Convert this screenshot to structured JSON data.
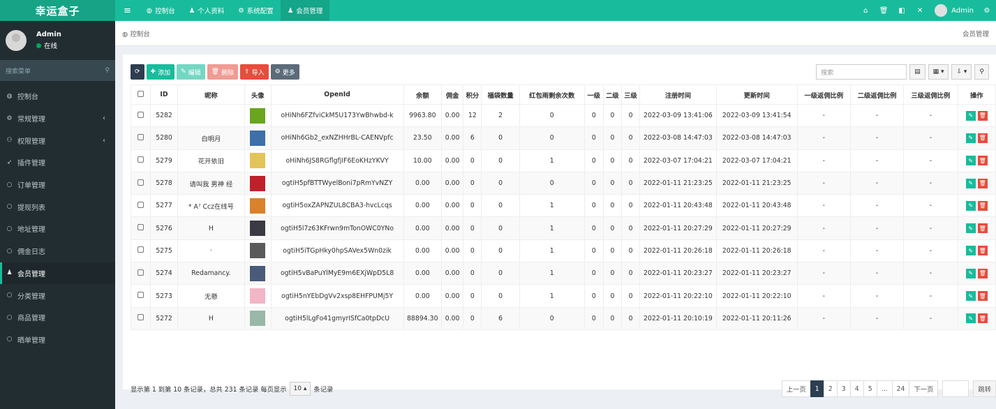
{
  "app": {
    "logo": "幸运盒子"
  },
  "topnav": {
    "items": [
      {
        "icon": "dashboard-icon",
        "glyph": "◍",
        "label": "控制台"
      },
      {
        "icon": "user-icon",
        "glyph": "♟",
        "label": "个人资料"
      },
      {
        "icon": "gear-icon",
        "glyph": "⚙",
        "label": "系统配置"
      },
      {
        "icon": "user-icon",
        "glyph": "♟",
        "label": "会员管理"
      }
    ],
    "user_name": "Admin"
  },
  "sidebar": {
    "user_name": "Admin",
    "status": "在线",
    "search_placeholder": "搜索菜单",
    "items": [
      {
        "label": "控制台",
        "glyph": "◍",
        "icon": "dashboard-icon"
      },
      {
        "label": "常规管理",
        "glyph": "⚙",
        "icon": "cogs-icon",
        "chev": "‹"
      },
      {
        "label": "权限管理",
        "glyph": "⚇",
        "icon": "group-icon",
        "chev": "‹"
      },
      {
        "label": "插件管理",
        "glyph": "➶",
        "icon": "rocket-icon"
      },
      {
        "label": "订单管理",
        "glyph": "○",
        "icon": "circle-icon"
      },
      {
        "label": "提现列表",
        "glyph": "○",
        "icon": "circle-icon"
      },
      {
        "label": "地址管理",
        "glyph": "○",
        "icon": "circle-icon"
      },
      {
        "label": "佣金日志",
        "glyph": "○",
        "icon": "circle-icon"
      },
      {
        "label": "会员管理",
        "glyph": "♟",
        "icon": "user-icon",
        "active": true
      },
      {
        "label": "分类管理",
        "glyph": "○",
        "icon": "circle-icon"
      },
      {
        "label": "商品管理",
        "glyph": "○",
        "icon": "circle-icon"
      },
      {
        "label": "晒单管理",
        "glyph": "○",
        "icon": "circle-icon"
      }
    ]
  },
  "breadcrumb": {
    "left": "控制台",
    "right": "会员管理"
  },
  "toolbar": {
    "add": "添加",
    "edit": "编辑",
    "delete": "删除",
    "import": "导入",
    "more": "更多",
    "search_placeholder": "搜索"
  },
  "table": {
    "headers": [
      "ID",
      "昵称",
      "头像",
      "OpenId",
      "余额",
      "佣金",
      "积分",
      "福袋数量",
      "红包雨剩余次数",
      "一级",
      "二级",
      "三级",
      "注册时间",
      "更新时间",
      "一级返佣比例",
      "二级返佣比例",
      "三级返佣比例",
      "操作"
    ],
    "rows": [
      {
        "id": "5282",
        "nick": "",
        "avatar_color": "#6aa51f",
        "openid": "oHiNh6FZfviCkM5U173YwBhwbd-k",
        "balance": "9963.80",
        "commission": "0.00",
        "points": "12",
        "bags": "2",
        "rain": "0",
        "l1": "0",
        "l2": "0",
        "l3": "0",
        "reg": "2022-03-09 13:41:06",
        "upd": "2022-03-09 13:41:54",
        "r1": "-",
        "r2": "-",
        "r3": "-"
      },
      {
        "id": "5280",
        "nick": "白明月",
        "avatar_color": "#3d6fa8",
        "openid": "oHiNh6Gb2_exNZHHrBL-CAENVpfc",
        "balance": "23.50",
        "commission": "0.00",
        "points": "6",
        "bags": "0",
        "rain": "0",
        "l1": "0",
        "l2": "0",
        "l3": "0",
        "reg": "2022-03-08 14:47:03",
        "upd": "2022-03-08 14:47:03",
        "r1": "-",
        "r2": "-",
        "r3": "-"
      },
      {
        "id": "5279",
        "nick": "花开依旧",
        "avatar_color": "#e3c45a",
        "openid": "oHiNh6JS8RGflgfjIF6EoKHzYKVY",
        "balance": "10.00",
        "commission": "0.00",
        "points": "0",
        "bags": "0",
        "rain": "1",
        "l1": "0",
        "l2": "0",
        "l3": "0",
        "reg": "2022-03-07 17:04:21",
        "upd": "2022-03-07 17:04:21",
        "r1": "-",
        "r2": "-",
        "r3": "-"
      },
      {
        "id": "5278",
        "nick": "请叫我 男神 经",
        "avatar_color": "#c0202a",
        "openid": "ogtiH5pfBTTWyelBoni7pRmYvNZY",
        "balance": "0.00",
        "commission": "0.00",
        "points": "0",
        "bags": "0",
        "rain": "0",
        "l1": "0",
        "l2": "0",
        "l3": "0",
        "reg": "2022-01-11 21:23:25",
        "upd": "2022-01-11 21:23:25",
        "r1": "-",
        "r2": "-",
        "r3": "-"
      },
      {
        "id": "5277",
        "nick": "* A⁷ Ccz在线号",
        "avatar_color": "#d9822b",
        "openid": "ogtiH5oxZAPNZUL8CBA3-hvcLcqs",
        "balance": "0.00",
        "commission": "0.00",
        "points": "0",
        "bags": "0",
        "rain": "1",
        "l1": "0",
        "l2": "0",
        "l3": "0",
        "reg": "2022-01-11 20:43:48",
        "upd": "2022-01-11 20:43:48",
        "r1": "-",
        "r2": "-",
        "r3": "-"
      },
      {
        "id": "5276",
        "nick": "H",
        "avatar_color": "#3a3a44",
        "openid": "ogtiH5l7z63KFrwn9mTonOWC0YNo",
        "balance": "0.00",
        "commission": "0.00",
        "points": "0",
        "bags": "0",
        "rain": "1",
        "l1": "0",
        "l2": "0",
        "l3": "0",
        "reg": "2022-01-11 20:27:29",
        "upd": "2022-01-11 20:27:29",
        "r1": "-",
        "r2": "-",
        "r3": "-"
      },
      {
        "id": "5275",
        "nick": "·",
        "avatar_color": "#5a5a5a",
        "openid": "ogtiH5iTGpHky0hpSAVex5Wn0zik",
        "balance": "0.00",
        "commission": "0.00",
        "points": "0",
        "bags": "0",
        "rain": "1",
        "l1": "0",
        "l2": "0",
        "l3": "0",
        "reg": "2022-01-11 20:26:18",
        "upd": "2022-01-11 20:26:18",
        "r1": "-",
        "r2": "-",
        "r3": "-"
      },
      {
        "id": "5274",
        "nick": "Redamancy.",
        "avatar_color": "#4a5a7a",
        "openid": "ogtiH5vBaPuYlMyE9m6EXjWpD5L8",
        "balance": "0.00",
        "commission": "0.00",
        "points": "0",
        "bags": "0",
        "rain": "1",
        "l1": "0",
        "l2": "0",
        "l3": "0",
        "reg": "2022-01-11 20:23:27",
        "upd": "2022-01-11 20:23:27",
        "r1": "-",
        "r2": "-",
        "r3": "-"
      },
      {
        "id": "5273",
        "nick": "无懸",
        "avatar_color": "#f2b6c6",
        "openid": "ogtiH5nYEbDgVv2xsp8EHFPUMj5Y",
        "balance": "0.00",
        "commission": "0.00",
        "points": "0",
        "bags": "0",
        "rain": "1",
        "l1": "0",
        "l2": "0",
        "l3": "0",
        "reg": "2022-01-11 20:22:10",
        "upd": "2022-01-11 20:22:10",
        "r1": "-",
        "r2": "-",
        "r3": "-"
      },
      {
        "id": "5272",
        "nick": "H",
        "avatar_color": "#9ab8a8",
        "openid": "ogtiH5lLgFo41gmyrISfCa0tpDcU",
        "balance": "88894.30",
        "commission": "0.00",
        "points": "0",
        "bags": "6",
        "rain": "0",
        "l1": "0",
        "l2": "0",
        "l3": "0",
        "reg": "2022-01-11 20:10:19",
        "upd": "2022-01-11 20:11:26",
        "r1": "-",
        "r2": "-",
        "r3": "-"
      }
    ]
  },
  "pagination": {
    "summary": "显示第 1 到第 10 条记录，总共 231 条记录 每页显示",
    "page_size": "10",
    "page_size_caret": "▴",
    "suffix": "条记录",
    "prev": "上一页",
    "pages": [
      "1",
      "2",
      "3",
      "4",
      "5",
      "...",
      "24"
    ],
    "current": "1",
    "next": "下一页",
    "jump": "跳转"
  }
}
